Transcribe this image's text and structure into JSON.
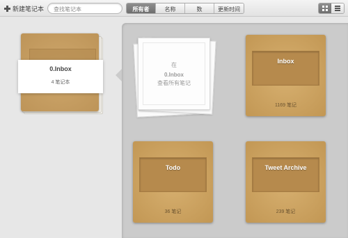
{
  "toolbar": {
    "new_notebook": "新建笔记本",
    "search_placeholder": "查找笔记本",
    "sort_tabs": [
      "所有者",
      "名称",
      "数",
      "更新时间"
    ]
  },
  "selected_stack": {
    "title": "0.Inbox",
    "count": "4 笔记本"
  },
  "stack_placeholder": {
    "line1": "在",
    "line2": "0.Inbox",
    "line3": "查看所有笔记"
  },
  "notebooks": [
    {
      "name": "Inbox",
      "count": "1169 笔记"
    },
    {
      "name": "Todo",
      "count": "36 笔记"
    },
    {
      "name": "Tweet Archive",
      "count": "239 笔记"
    }
  ],
  "colors": {
    "cover": "#c9a061",
    "panel": "#cbcbcb",
    "active_tab": "#7f7f7f"
  }
}
